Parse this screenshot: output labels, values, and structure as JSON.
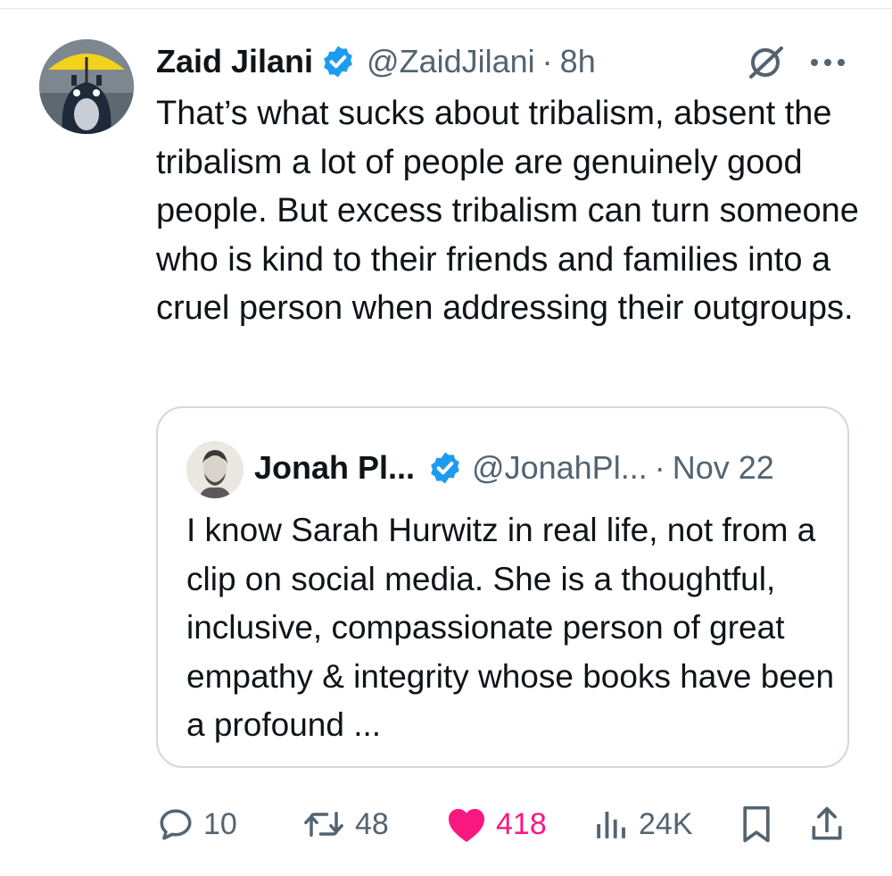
{
  "tweet": {
    "author_name": "Zaid Jilani",
    "author_handle": "@ZaidJilani",
    "separator": "·",
    "time": "8h",
    "text": "That’s what sucks about tribalism, absent the tribalism a lot of people are genuinely good people. But excess tribalism can turn someone who is kind to their friends and families into a cruel person when addressing their outgroups.",
    "verified": true
  },
  "quote": {
    "author_name": "Jonah Pl...",
    "author_handle": "@JonahPl...",
    "separator": "·",
    "time": "Nov 22",
    "text": "I know Sarah Hurwitz in real life, not from a clip on social media. She is a thoughtful, inclusive, compassionate person of great empathy & integrity whose books have been a profound ...",
    "verified": true
  },
  "actions": {
    "replies": "10",
    "reposts": "48",
    "likes": "418",
    "views": "24K"
  },
  "colors": {
    "text_primary": "#0f1419",
    "text_secondary": "#536471",
    "verified_blue": "#1d9bf0",
    "like_pink": "#f91880",
    "border": "#cfd9de"
  },
  "icons": {
    "verified": "verified-badge-icon",
    "grok": "grok-icon",
    "more": "more-options-icon",
    "reply": "reply-icon",
    "repost": "repost-icon",
    "like": "heart-icon",
    "views": "views-chart-icon",
    "bookmark": "bookmark-icon",
    "share": "share-icon"
  }
}
